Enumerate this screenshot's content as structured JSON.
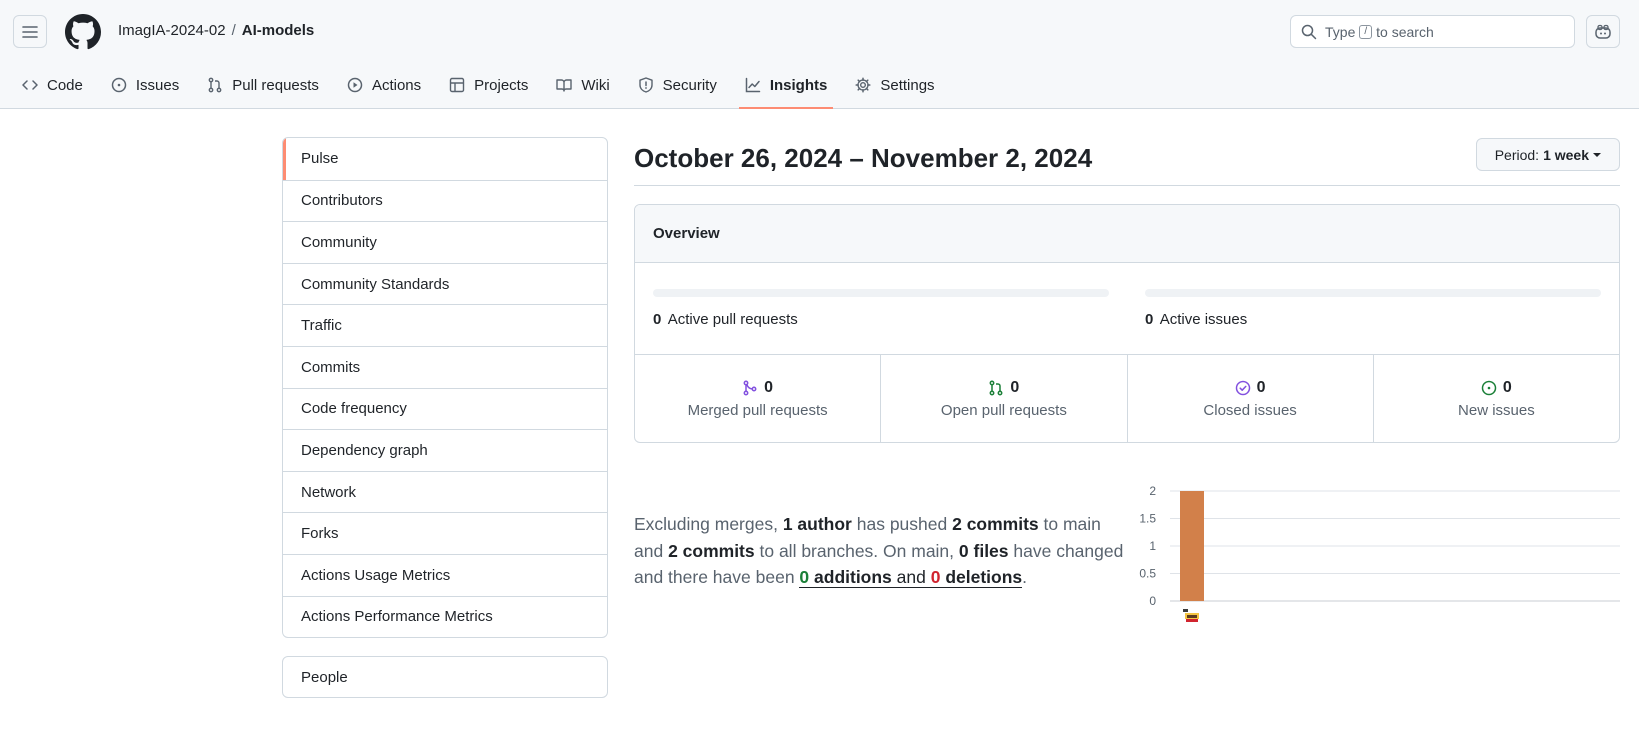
{
  "header": {
    "owner": "ImagIA-2024-02",
    "separator": "/",
    "repo": "AI-models",
    "search": {
      "before": "Type",
      "key": "/",
      "after": "to search"
    }
  },
  "tabs": [
    {
      "label": "Code",
      "icon": "code-icon"
    },
    {
      "label": "Issues",
      "icon": "issue-icon"
    },
    {
      "label": "Pull requests",
      "icon": "pull-request-icon"
    },
    {
      "label": "Actions",
      "icon": "play-icon"
    },
    {
      "label": "Projects",
      "icon": "table-icon"
    },
    {
      "label": "Wiki",
      "icon": "book-icon"
    },
    {
      "label": "Security",
      "icon": "shield-icon"
    },
    {
      "label": "Insights",
      "icon": "graph-icon",
      "active": true
    },
    {
      "label": "Settings",
      "icon": "gear-icon"
    }
  ],
  "sidebar": {
    "items": [
      {
        "label": "Pulse",
        "selected": true
      },
      {
        "label": "Contributors"
      },
      {
        "label": "Community"
      },
      {
        "label": "Community Standards"
      },
      {
        "label": "Traffic"
      },
      {
        "label": "Commits"
      },
      {
        "label": "Code frequency"
      },
      {
        "label": "Dependency graph"
      },
      {
        "label": "Network"
      },
      {
        "label": "Forks"
      },
      {
        "label": "Actions Usage Metrics"
      },
      {
        "label": "Actions Performance Metrics"
      }
    ],
    "people": "People"
  },
  "main": {
    "date_range": "October 26, 2024 – November 2, 2024",
    "period": {
      "label": "Period:",
      "value": "1 week"
    },
    "overview": {
      "title": "Overview",
      "active_prs": {
        "count": "0",
        "label": "Active pull requests"
      },
      "active_issues": {
        "count": "0",
        "label": "Active issues"
      },
      "stats": [
        {
          "count": "0",
          "label": "Merged pull requests",
          "icon": "git-merge-icon",
          "color": "#8250df"
        },
        {
          "count": "0",
          "label": "Open pull requests",
          "icon": "git-pull-request-icon",
          "color": "#1a7f37"
        },
        {
          "count": "0",
          "label": "Closed issues",
          "icon": "issue-closed-icon",
          "color": "#8250df"
        },
        {
          "count": "0",
          "label": "New issues",
          "icon": "issue-opened-icon",
          "color": "#1a7f37"
        }
      ]
    },
    "summary": {
      "t1": "Excluding merges, ",
      "authors": "1 author",
      "t2": " has pushed ",
      "commits_main": "2 commits",
      "t3": " to main and ",
      "commits_all": "2 commits",
      "t4": " to all branches. On main, ",
      "files": "0 files",
      "t5": " have changed and there have been ",
      "additions_num": "0",
      "additions_word": " additions",
      "t6": " and ",
      "deletions_num": "0",
      "deletions_word": " deletions",
      "t7": "."
    }
  },
  "colors": {
    "accent_tab": "#fd8c73",
    "bar": "#d2804a",
    "green": "#1a7f37",
    "red": "#d1242f"
  },
  "chart_data": {
    "type": "bar",
    "categories": [
      "author-1"
    ],
    "values": [
      2
    ],
    "ylim": [
      0,
      2
    ],
    "yticks": [
      "0",
      "0.5",
      "1",
      "1.5",
      "2"
    ],
    "grid": true
  }
}
